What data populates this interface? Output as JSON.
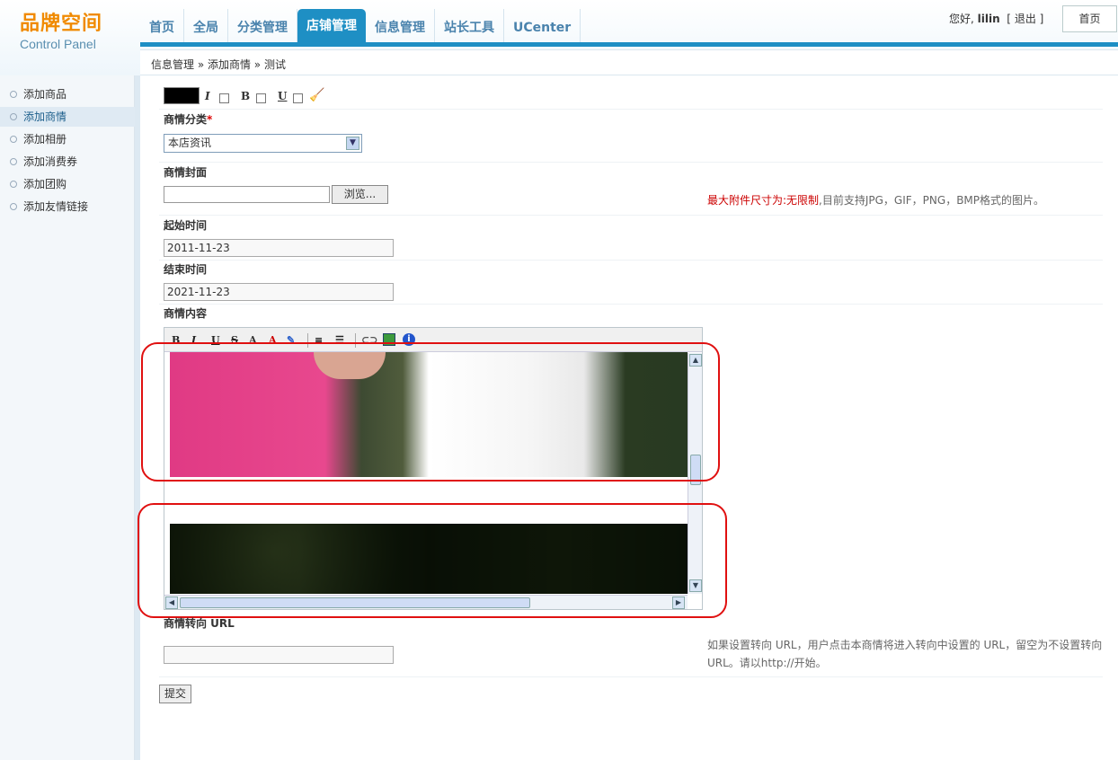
{
  "header": {
    "logo_title": "品牌空间",
    "logo_subtitle": "Control Panel",
    "nav": [
      {
        "label": "首页"
      },
      {
        "label": "全局"
      },
      {
        "label": "分类管理"
      },
      {
        "label": "店铺管理"
      },
      {
        "label": "信息管理"
      },
      {
        "label": "站长工具"
      },
      {
        "label": "UCenter"
      }
    ],
    "active_nav": "店铺管理",
    "greeting": "您好,",
    "username": "lilin",
    "logout_open": "[",
    "logout_label": "退出",
    "logout_close": "]",
    "home_button": "首页"
  },
  "breadcrumb": "信息管理 » 添加商情 » 测试",
  "sidebar": {
    "items": [
      {
        "label": "添加商品"
      },
      {
        "label": "添加商情"
      },
      {
        "label": "添加相册"
      },
      {
        "label": "添加消费券"
      },
      {
        "label": "添加团购"
      },
      {
        "label": "添加友情链接"
      }
    ],
    "active": "添加商情"
  },
  "form": {
    "title_format": {
      "italic_label": "I",
      "bold_label": "B",
      "underline_label": "U",
      "color_value": "#000000"
    },
    "category_label": "商情分类",
    "required_mark": "*",
    "category_value": "本店资讯",
    "cover_label": "商情封面",
    "browse_button": "浏览...",
    "file_hint_red": "最大附件尺寸为:无限制",
    "file_hint_rest": ",目前支持JPG，GIF，PNG，BMP格式的图片。",
    "start_label": "起始时间",
    "start_value": "2011-11-23",
    "end_label": "结束时间",
    "end_value": "2021-11-23",
    "content_label": "商情内容",
    "editor_toolbar": [
      "B",
      "I",
      "U",
      "S"
    ],
    "url_label": "商情转向 URL",
    "url_value": "",
    "url_hint": "如果设置转向 URL，用户点击本商情将进入转向中设置的 URL，留空为不设置转向 URL。请以http://开始。",
    "submit_button": "提交"
  },
  "colors": {
    "accent": "#1e8fc4",
    "logo_orange": "#f08a00",
    "highlight_red": "#e01010"
  }
}
